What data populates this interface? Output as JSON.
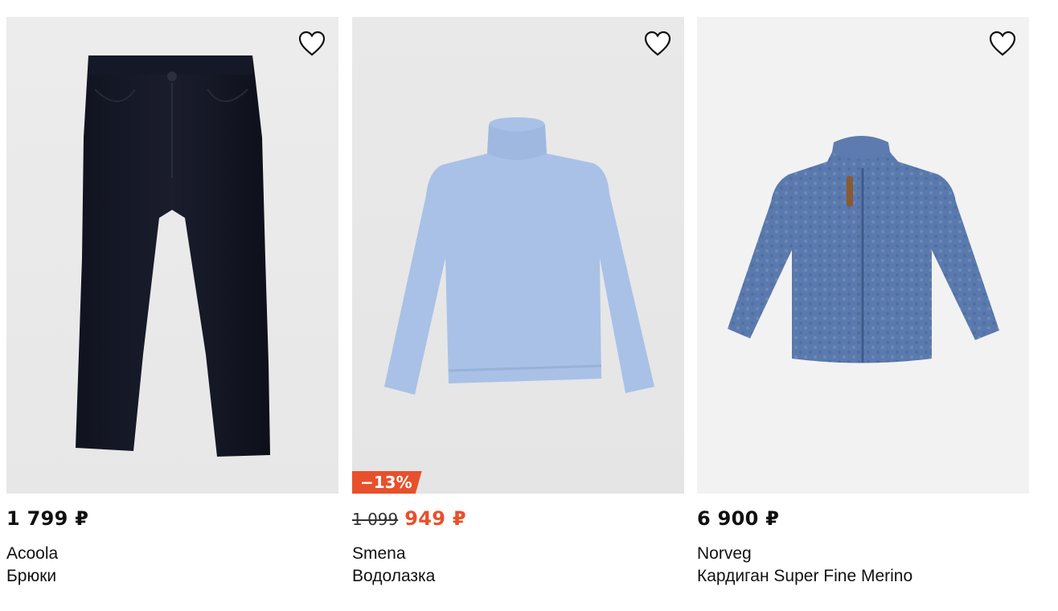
{
  "products": [
    {
      "brand": "Acoola",
      "title": "Брюки",
      "price": "1 799 ₽",
      "image": "dark-navy-corduroy-trousers",
      "icon": "heart-outline-icon"
    },
    {
      "brand": "Smena",
      "title": "Водолазка",
      "price": "949 ₽",
      "old_price": "1 099",
      "discount": "−13%",
      "image": "light-blue-turtleneck",
      "icon": "heart-outline-icon"
    },
    {
      "brand": "Norveg",
      "title": "Кардиган Super Fine Merino",
      "price": "6 900 ₽",
      "image": "blue-cable-knit-zip-cardigan",
      "icon": "heart-outline-icon"
    }
  ],
  "colors": {
    "accent": "#e8502b",
    "text": "#111111",
    "photo_bg": "#ececec"
  }
}
